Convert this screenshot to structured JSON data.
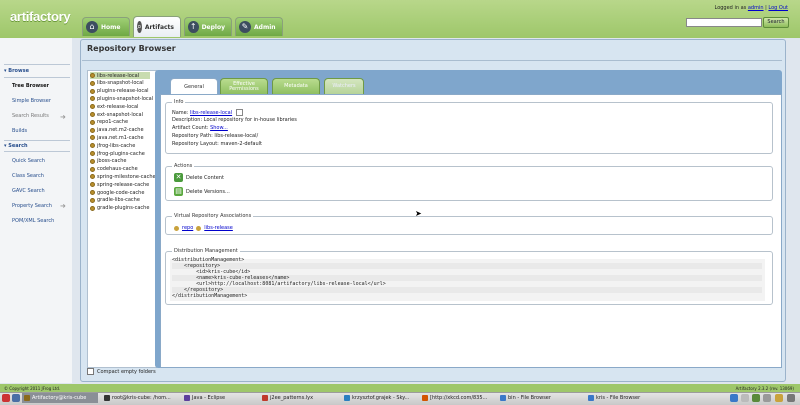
{
  "app": {
    "logo": "artifactory"
  },
  "top_tabs": [
    {
      "label": "Home",
      "icon": "home-icon",
      "active": false
    },
    {
      "label": "Artifacts",
      "icon": "search-icon",
      "active": true
    },
    {
      "label": "Deploy",
      "icon": "upload-icon",
      "active": false
    },
    {
      "label": "Admin",
      "icon": "wrench-icon",
      "active": false
    }
  ],
  "user": {
    "logged_in_prefix": "Logged in as",
    "username": "admin",
    "separator": "|",
    "logout": "Log Out"
  },
  "search": {
    "button_label": "Search",
    "value": ""
  },
  "nav": {
    "browse_header": "Browse",
    "browse_items": [
      "Tree Browser",
      "Simple Browser",
      "Search Results",
      "Builds"
    ],
    "search_header": "Search",
    "search_items": [
      "Quick Search",
      "Class Search",
      "GAVC Search",
      "Property Search",
      "POM/XML Search"
    ]
  },
  "page": {
    "title": "Repository Browser"
  },
  "tree": {
    "items": [
      "libs-release-local",
      "libs-snapshot-local",
      "plugins-release-local",
      "plugins-snapshot-local",
      "ext-release-local",
      "ext-snapshot-local",
      "repo1-cache",
      "java.net.m2-cache",
      "java.net.m1-cache",
      "jfrog-libs-cache",
      "jfrog-plugins-cache",
      "jboss-cache",
      "codehaus-cache",
      "spring-milestone-cache",
      "spring-release-cache",
      "google-code-cache",
      "gradle-libs-cache",
      "gradle-plugins-cache"
    ],
    "selected_index": 0,
    "compact_label": "Compact empty folders"
  },
  "detail_tabs": [
    "General",
    "Effective Permissions",
    "Metadata",
    "Watchers"
  ],
  "info": {
    "legend": "Info",
    "name_label": "Name:",
    "name_value": "libs-release-local",
    "description": "Description: Local repository for in-house libraries",
    "artifact_count_label": "Artifact Count:",
    "artifact_count_link": "Show...",
    "repo_path": "Repository Path: libs-release-local/",
    "repo_layout": "Repository Layout: maven-2-default"
  },
  "actions": {
    "legend": "Actions",
    "items": [
      "Delete Content",
      "Delete Versions..."
    ]
  },
  "virtual": {
    "legend": "Virtual Repository Associations",
    "items": [
      "repo",
      "libs-release"
    ]
  },
  "distribution": {
    "legend": "Distribution Management",
    "lines": [
      "<distributionManagement>",
      "    <repository>",
      "        <id>kris-cube</id>",
      "        <name>kris-cube-releases</name>",
      "        <url>http://localhost:8081/artifactory/libs-release-local</url>",
      "    </repository>",
      "</distributionManagement>"
    ]
  },
  "footer": {
    "copyright": "© Copyright 2011 JFrog Ltd.",
    "version": "Artifactory 2.3.2 (rev. 13069)"
  },
  "taskbar": {
    "tasks": [
      "Artifactory@kris-cube",
      "root@kris-cube: /hom...",
      "Java - Eclipse",
      "j2ee_patterns.lyx",
      "krzysztof.grajek - Sky...",
      "[http://xkcd.com/835...",
      "bin - File Browser",
      "kris - File Browser"
    ],
    "active_index": 0
  },
  "colors": {
    "header_green": "#9ec76a",
    "link_blue": "#0000cc",
    "panel_blue": "#7fa6cc"
  }
}
